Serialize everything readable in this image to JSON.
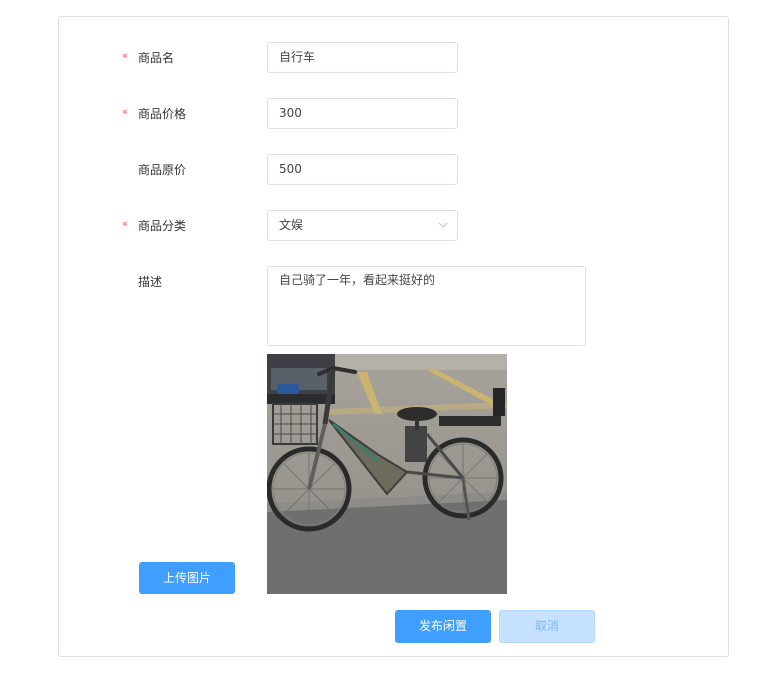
{
  "form": {
    "name": {
      "label": "商品名",
      "value": "自行车",
      "required": true
    },
    "price": {
      "label": "商品价格",
      "value": "300",
      "required": true
    },
    "original_price": {
      "label": "商品原价",
      "value": "500",
      "required": false
    },
    "category": {
      "label": "商品分类",
      "value": "文娱",
      "required": true
    },
    "description": {
      "label": "描述",
      "value": "自己骑了一年，看起来挺好的"
    },
    "required_mark": "*"
  },
  "upload_button_label": "上传图片",
  "actions": {
    "publish_label": "发布闲置",
    "cancel_label": "取消"
  },
  "colors": {
    "primary": "#409eff",
    "cancel_bg": "#c6e2ff",
    "required": "#f56c6c"
  },
  "icons": {
    "select_arrow": "chevron-down-icon"
  }
}
